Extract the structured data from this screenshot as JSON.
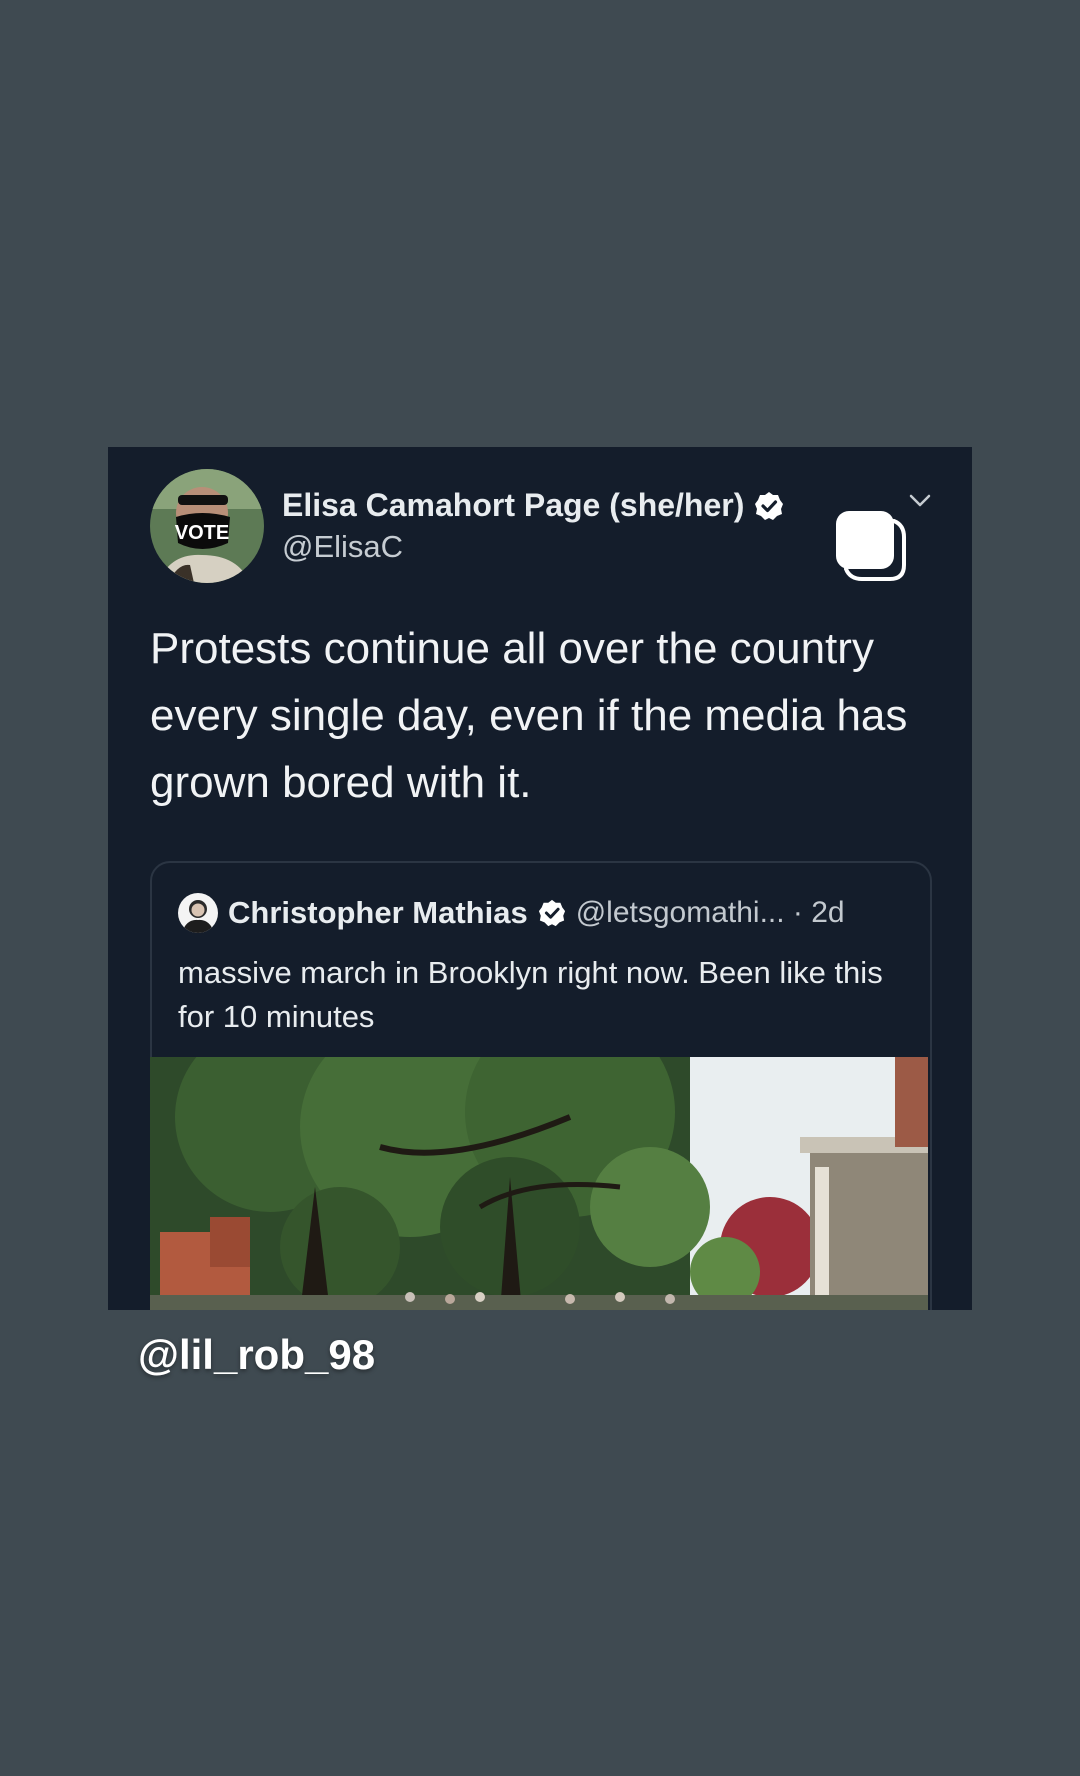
{
  "tweet": {
    "author_name": "Elisa Camahort Page (she/her)",
    "author_handle": "@ElisaC",
    "text": "Protests continue all over the country every single day, even if the media has grown bored with it.",
    "avatar_mask_text": "VOTE",
    "icons": {
      "verified": "verified-badge-icon",
      "more": "chevron-down-icon",
      "copy": "copy-icon"
    },
    "quote": {
      "author_name": "Christopher Mathias",
      "author_meta": "@letsgomathi... · 2d",
      "text": "massive march in Brooklyn right now. Been like this for 10 minutes",
      "media": "street-photo-trees"
    }
  },
  "watermark": "@lil_rob_98",
  "colors": {
    "page_background": "#3f4a51",
    "card_background": "#141d2b",
    "text_primary": "#f1f3f5",
    "text_secondary": "#c6ccd2"
  }
}
